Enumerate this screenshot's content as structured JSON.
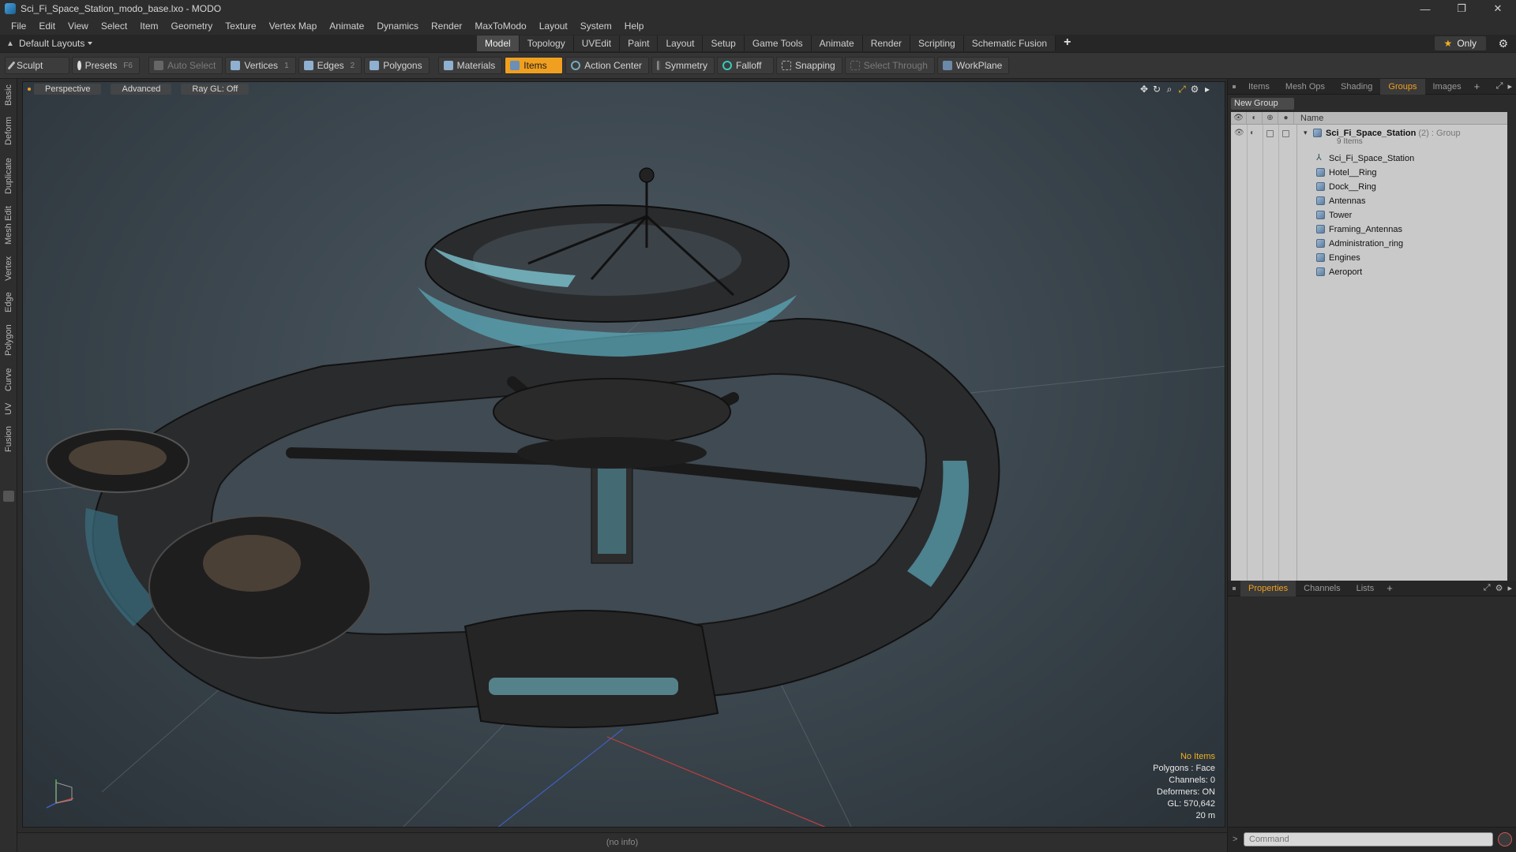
{
  "window": {
    "title": "Sci_Fi_Space_Station_modo_base.lxo - MODO",
    "controls": [
      "—",
      "❐",
      "✕"
    ]
  },
  "menu": [
    "File",
    "Edit",
    "View",
    "Select",
    "Item",
    "Geometry",
    "Texture",
    "Vertex Map",
    "Animate",
    "Dynamics",
    "Render",
    "MaxToModo",
    "Layout",
    "System",
    "Help"
  ],
  "layoutbar": {
    "layouts_label": "Default Layouts",
    "tabs": [
      "Model",
      "Topology",
      "UVEdit",
      "Paint",
      "Layout",
      "Setup",
      "Game Tools",
      "Animate",
      "Render",
      "Scripting",
      "Schematic Fusion"
    ],
    "active_tab": "Model",
    "add_label": "+",
    "only_label": "Only"
  },
  "toolbar": {
    "sculpt": "Sculpt",
    "presets": "Presets",
    "presets_key": "F6",
    "auto_select": "Auto Select",
    "vertices": "Vertices",
    "vertices_count": "1",
    "edges": "Edges",
    "edges_count": "2",
    "polygons": "Polygons",
    "materials": "Materials",
    "items": "Items",
    "action_center": "Action Center",
    "symmetry": "Symmetry",
    "falloff": "Falloff",
    "snapping": "Snapping",
    "select_through": "Select Through",
    "workplane": "WorkPlane"
  },
  "left_tabs": [
    "Basic",
    "Deform",
    "Duplicate",
    "Mesh Edit",
    "Vertex",
    "Edge",
    "Polygon",
    "Curve",
    "UV",
    "Fusion"
  ],
  "viewport": {
    "view_label": "Perspective",
    "shading_label": "Advanced",
    "raygl_label": "Ray GL: Off",
    "info": {
      "selection": "No Items",
      "polygons": "Polygons : Face",
      "channels": "Channels: 0",
      "deformers": "Deformers: ON",
      "gl": "GL: 570,642",
      "scale": "20 m"
    }
  },
  "status": {
    "info": "(no info)"
  },
  "right_panel": {
    "top_tabs": [
      "Items",
      "Mesh Ops",
      "Shading",
      "Groups",
      "Images"
    ],
    "active_top_tab": "Groups",
    "new_group": "New Group",
    "name_header": "Name",
    "group": {
      "name": "Sci_Fi_Space_Station",
      "count": "(2)",
      "type": ": Group",
      "sub": "9 Items"
    },
    "items": [
      "Sci_Fi_Space_Station",
      "Hotel__Ring",
      "Dock__Ring",
      "Antennas",
      "Tower",
      "Framing_Antennas",
      "Administration_ring",
      "Engines",
      "Aeroport"
    ],
    "bottom_tabs": [
      "Properties",
      "Channels",
      "Lists"
    ],
    "active_bottom_tab": "Properties",
    "command_placeholder": "Command"
  }
}
